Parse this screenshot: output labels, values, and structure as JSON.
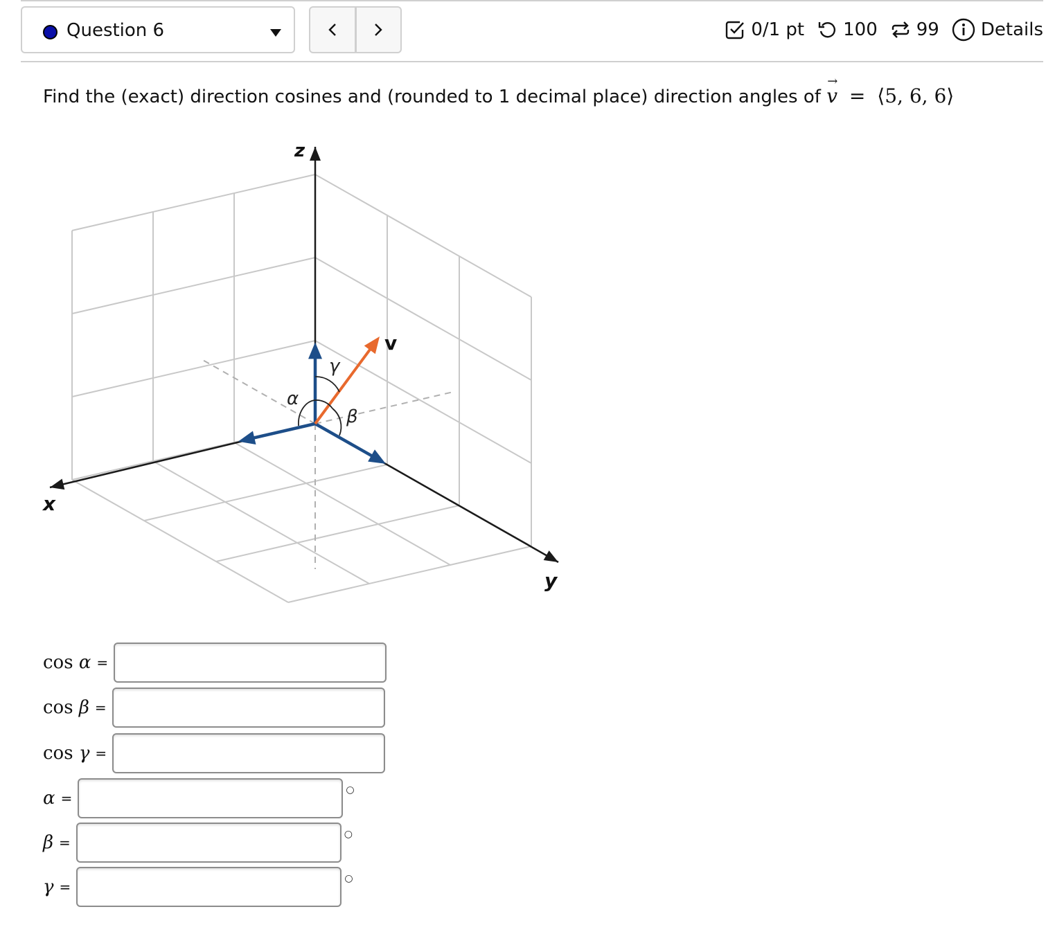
{
  "header": {
    "question_select": {
      "label": "Question 6",
      "status_color": "#0a0fa8"
    },
    "nav": {
      "prev_icon": "chevron-left-icon",
      "next_icon": "chevron-right-icon"
    },
    "status": {
      "score": "0/1 pt",
      "retries": "100",
      "attempts": "99",
      "details_label": "Details"
    }
  },
  "question": {
    "text": "Find the (exact) direction cosines and (rounded to 1 decimal place) direction angles of",
    "vector_name": "v",
    "equals": "=",
    "vector_value": "⟨5, 6, 6⟩"
  },
  "diagram": {
    "axis_labels": {
      "x": "x",
      "y": "y",
      "z": "z"
    },
    "vector_label": "v",
    "angle_labels": {
      "alpha": "α",
      "beta": "β",
      "gamma": "γ"
    },
    "colors": {
      "axis": "#1a1a1a",
      "unit_vector": "#1d4e89",
      "vector": "#e8692d",
      "grid": "#c8c8c8",
      "dashed": "#b0b0b0"
    }
  },
  "answers": [
    {
      "label_prefix": "cos",
      "symbol": "α",
      "equals": "=",
      "value": "",
      "unit": ""
    },
    {
      "label_prefix": "cos",
      "symbol": "β",
      "equals": "=",
      "value": "",
      "unit": ""
    },
    {
      "label_prefix": "cos",
      "symbol": "γ",
      "equals": "=",
      "value": "",
      "unit": ""
    },
    {
      "label_prefix": "",
      "symbol": "α",
      "equals": "=",
      "value": "",
      "unit": "°"
    },
    {
      "label_prefix": "",
      "symbol": "β",
      "equals": "=",
      "value": "",
      "unit": "°"
    },
    {
      "label_prefix": "",
      "symbol": "γ",
      "equals": "=",
      "value": "",
      "unit": "°"
    }
  ]
}
